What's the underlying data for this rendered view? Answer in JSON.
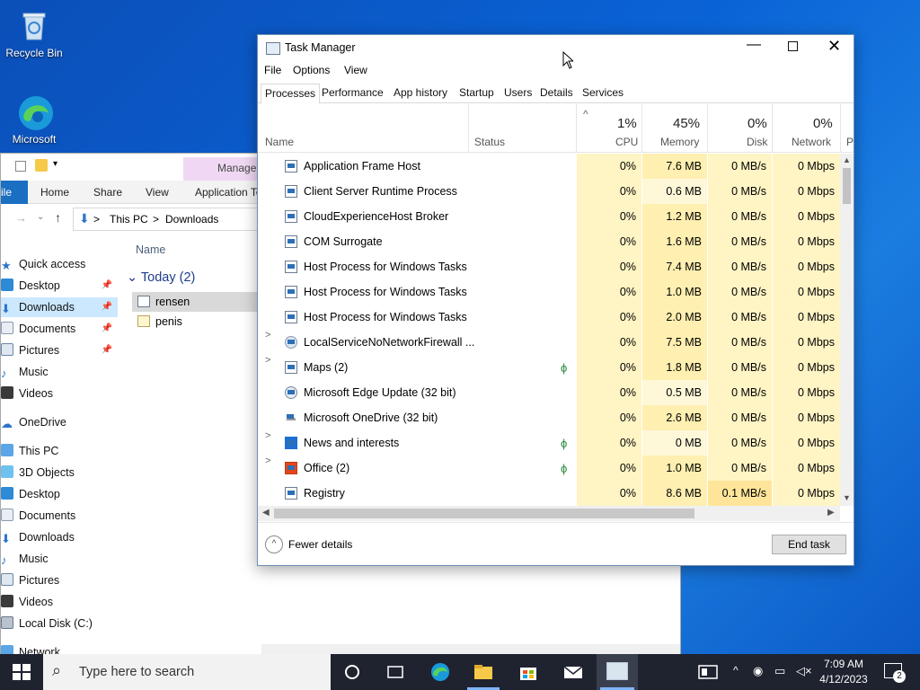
{
  "desktop": {
    "recycle_bin": "Recycle Bin",
    "edge_label": "Microsoft"
  },
  "explorer": {
    "ribbon": {
      "file": "ile",
      "home": "Home",
      "share": "Share",
      "view": "View",
      "manage": "Manage",
      "app_tools": "Application To"
    },
    "breadcrumb": {
      "this_pc": "This PC",
      "sep": ">",
      "downloads": "Downloads"
    },
    "column_name": "Name",
    "group_header": "Today (2)",
    "files": [
      "rensen",
      "penis"
    ],
    "nav": {
      "quick_access": "Quick access",
      "desktop": "Desktop",
      "downloads": "Downloads",
      "documents": "Documents",
      "pictures": "Pictures",
      "music": "Music",
      "videos": "Videos",
      "onedrive": "OneDrive",
      "this_pc": "This PC",
      "objects3d": "3D Objects",
      "pc_desktop": "Desktop",
      "pc_documents": "Documents",
      "pc_downloads": "Downloads",
      "pc_music": "Music",
      "pc_pictures": "Pictures",
      "pc_videos": "Videos",
      "local_disk": "Local Disk (C:)",
      "network": "Network"
    }
  },
  "task_manager": {
    "title": "Task Manager",
    "menu": {
      "file": "File",
      "options": "Options",
      "view": "View"
    },
    "tabs": [
      "Processes",
      "Performance",
      "App history",
      "Startup",
      "Users",
      "Details",
      "Services"
    ],
    "columns": {
      "name": "Name",
      "status": "Status",
      "cpu_pct": "1%",
      "cpu": "CPU",
      "mem_pct": "45%",
      "memory": "Memory",
      "disk_pct": "0%",
      "disk": "Disk",
      "net_pct": "0%",
      "network": "Network",
      "extra": "P"
    },
    "rows": [
      {
        "name": "Application Frame Host",
        "cpu": "0%",
        "memory": "7.6 MB",
        "disk": "0 MB/s",
        "network": "0 Mbps"
      },
      {
        "name": "Client Server Runtime Process",
        "cpu": "0%",
        "memory": "0.6 MB",
        "disk": "0 MB/s",
        "network": "0 Mbps"
      },
      {
        "name": "CloudExperienceHost Broker",
        "cpu": "0%",
        "memory": "1.2 MB",
        "disk": "0 MB/s",
        "network": "0 Mbps"
      },
      {
        "name": "COM Surrogate",
        "cpu": "0%",
        "memory": "1.6 MB",
        "disk": "0 MB/s",
        "network": "0 Mbps"
      },
      {
        "name": "Host Process for Windows Tasks",
        "cpu": "0%",
        "memory": "7.4 MB",
        "disk": "0 MB/s",
        "network": "0 Mbps"
      },
      {
        "name": "Host Process for Windows Tasks",
        "cpu": "0%",
        "memory": "1.0 MB",
        "disk": "0 MB/s",
        "network": "0 Mbps"
      },
      {
        "name": "Host Process for Windows Tasks",
        "cpu": "0%",
        "memory": "2.0 MB",
        "disk": "0 MB/s",
        "network": "0 Mbps"
      },
      {
        "name": "LocalServiceNoNetworkFirewall ...",
        "cpu": "0%",
        "memory": "7.5 MB",
        "disk": "0 MB/s",
        "network": "0 Mbps"
      },
      {
        "name": "Maps (2)",
        "cpu": "0%",
        "memory": "1.8 MB",
        "disk": "0 MB/s",
        "network": "0 Mbps"
      },
      {
        "name": "Microsoft Edge Update (32 bit)",
        "cpu": "0%",
        "memory": "0.5 MB",
        "disk": "0 MB/s",
        "network": "0 Mbps"
      },
      {
        "name": "Microsoft OneDrive (32 bit)",
        "cpu": "0%",
        "memory": "2.6 MB",
        "disk": "0 MB/s",
        "network": "0 Mbps"
      },
      {
        "name": "News and interests",
        "cpu": "0%",
        "memory": "0 MB",
        "disk": "0 MB/s",
        "network": "0 Mbps"
      },
      {
        "name": "Office (2)",
        "cpu": "0%",
        "memory": "1.0 MB",
        "disk": "0 MB/s",
        "network": "0 Mbps"
      },
      {
        "name": "Registry",
        "cpu": "0%",
        "memory": "8.6 MB",
        "disk": "0.1 MB/s",
        "network": "0 Mbps"
      }
    ],
    "footer": {
      "fewer_details": "Fewer details",
      "end_task": "End task"
    }
  },
  "taskbar": {
    "search_placeholder": "Type here to search",
    "time": "7:09 AM",
    "date": "4/12/2023",
    "notif_count": "2"
  }
}
